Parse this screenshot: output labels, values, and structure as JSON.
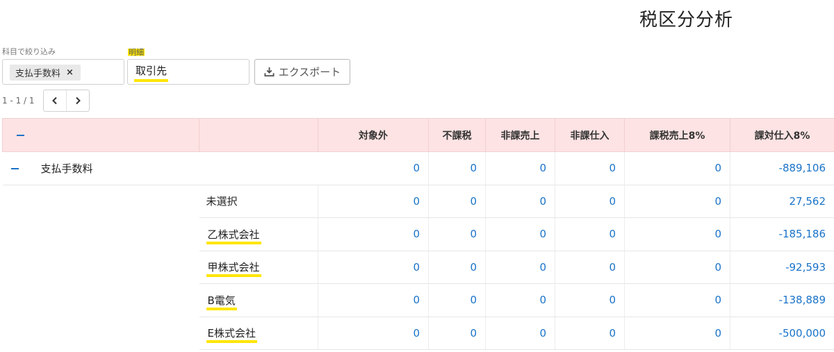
{
  "title": "税区分分析",
  "filter": {
    "label": "科目で絞り込み",
    "chip": "支払手数料",
    "chip_remove": "×"
  },
  "detail": {
    "label": "明細",
    "value": "取引先"
  },
  "export": {
    "label": "エクスポート"
  },
  "pagination": {
    "text": "1 - 1 / 1"
  },
  "table": {
    "headers": [
      "対象外",
      "不課税",
      "非課売上",
      "非課仕入",
      "課税売上8%",
      "課対仕入8%"
    ],
    "group": {
      "name": "支払手数料",
      "values": [
        "0",
        "0",
        "0",
        "0",
        "0",
        "-889,106"
      ]
    },
    "rows": [
      {
        "name": "未選択",
        "values": [
          "0",
          "0",
          "0",
          "0",
          "0",
          "27,562"
        ]
      },
      {
        "name": "乙株式会社",
        "values": [
          "0",
          "0",
          "0",
          "0",
          "0",
          "-185,186"
        ]
      },
      {
        "name": "甲株式会社",
        "values": [
          "0",
          "0",
          "0",
          "0",
          "0",
          "-92,593"
        ]
      },
      {
        "name": "B電気",
        "values": [
          "0",
          "0",
          "0",
          "0",
          "0",
          "-138,889"
        ]
      },
      {
        "name": "E株式会社",
        "values": [
          "0",
          "0",
          "0",
          "0",
          "0",
          "-500,000"
        ]
      }
    ]
  },
  "colors": {
    "accent": "#1a73c8",
    "header_bg": "#fde3e3",
    "highlight": "#ffe600"
  }
}
